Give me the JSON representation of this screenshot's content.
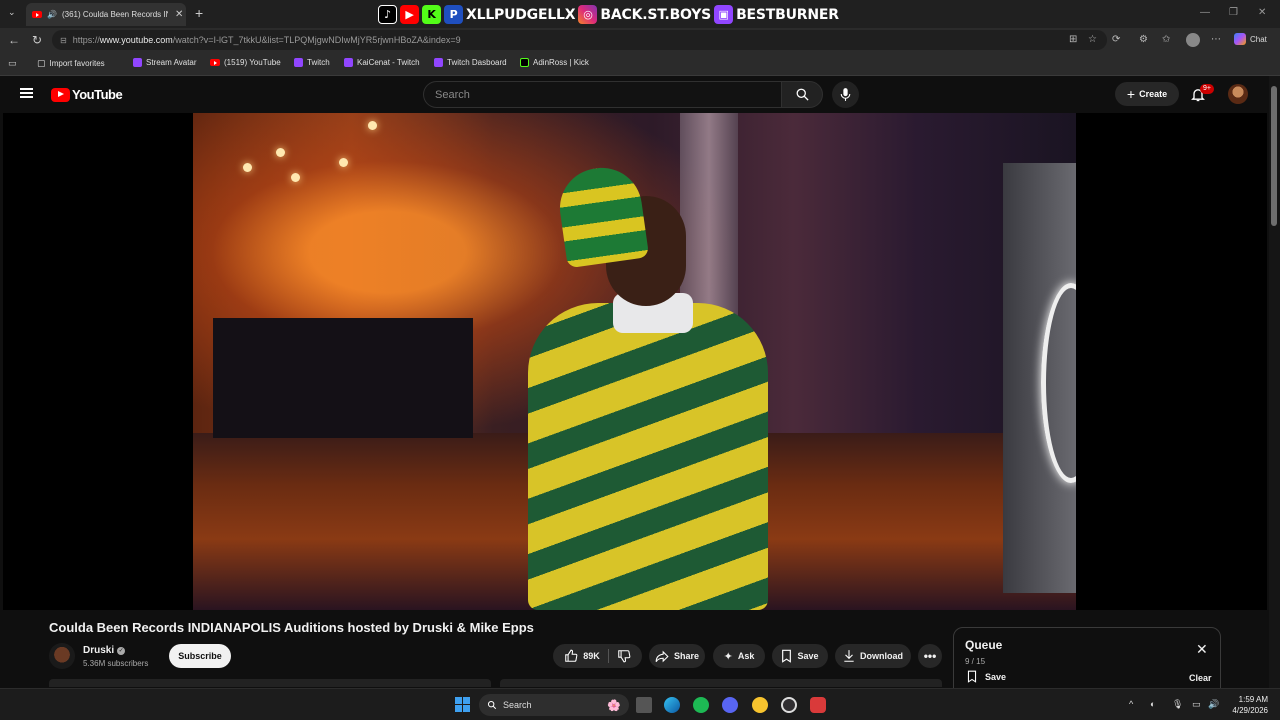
{
  "browser": {
    "tab": {
      "title": "(361) Coulda Been Records IN",
      "close_label": "✕"
    },
    "new_tab_label": "+",
    "banner": {
      "name1": "XLLPUDGELLX",
      "name2": "BACK.ST.BOYS",
      "name3": "BESTBURNER"
    },
    "address": {
      "prefix": "https://",
      "host": "www.youtube.com",
      "path": "/watch?v=I-lGT_7tkkU&list=TLPQMjgwNDIwMjYR5rjwnHBoZA&index=9"
    },
    "chat_label": "Chat",
    "bookmarks": [
      {
        "label": "Import favorites"
      },
      {
        "label": "Stream Avatar"
      },
      {
        "label": "(1519) YouTube"
      },
      {
        "label": "Twitch"
      },
      {
        "label": "KaiCenat - Twitch"
      },
      {
        "label": "Twitch Dasboard"
      },
      {
        "label": "AdinRoss | Kick"
      }
    ]
  },
  "youtube": {
    "logo_text": "YouTube",
    "search_placeholder": "Search",
    "create_label": "Create",
    "notif_count": "9+",
    "video": {
      "title": "Coulda Been Records INDIANAPOLIS Auditions hosted by Druski & Mike Epps",
      "channel": "Druski",
      "subscribers": "5.36M subscribers",
      "subscribe_label": "Subscribe",
      "likes": "89K",
      "share_label": "Share",
      "ask_label": "Ask",
      "save_label": "Save",
      "download_label": "Download"
    },
    "queue": {
      "title": "Queue",
      "count": "9 / 15",
      "save_label": "Save",
      "clear_label": "Clear",
      "close_label": "✕"
    }
  },
  "taskbar": {
    "search_label": "Search",
    "time": "1:59 AM",
    "date": "4/29/2026"
  },
  "colors": {
    "youtube_red": "#ff0000",
    "twitch_purple": "#9146ff",
    "kick_green": "#53fc18",
    "windows_blue": "#3ea0f0"
  }
}
